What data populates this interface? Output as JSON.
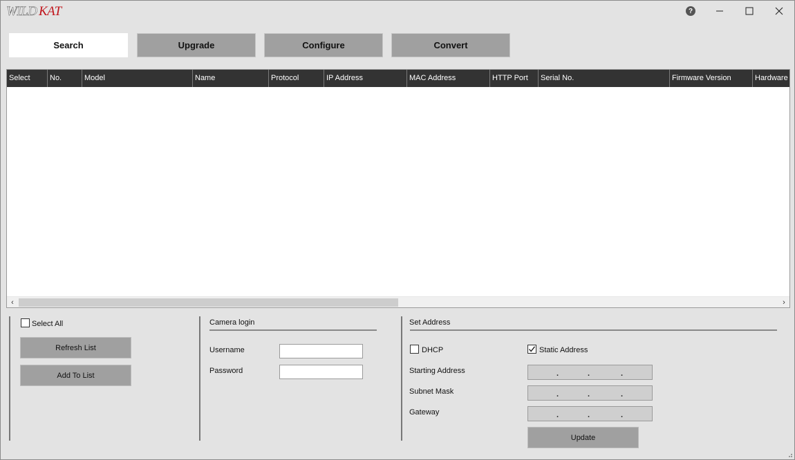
{
  "app": {
    "logo_text": "WildKat"
  },
  "titlebar": {
    "help_glyph": "?",
    "minimize_glyph": "—",
    "maximize_glyph": "☐",
    "close_glyph": "✕"
  },
  "tabs": [
    {
      "label": "Search",
      "active": true
    },
    {
      "label": "Upgrade",
      "active": false
    },
    {
      "label": "Configure",
      "active": false
    },
    {
      "label": "Convert",
      "active": false
    }
  ],
  "grid": {
    "columns": [
      "Select",
      "No.",
      "Model",
      "Name",
      "Protocol",
      "IP Address",
      "MAC Address",
      "HTTP Port",
      "Serial No.",
      "Firmware Version",
      "Hardware"
    ],
    "rows": [],
    "scroll_left_glyph": "‹",
    "scroll_right_glyph": "›"
  },
  "list_panel": {
    "select_all_label": "Select All",
    "select_all_checked": false,
    "refresh_label": "Refresh List",
    "add_label": "Add To List"
  },
  "login_panel": {
    "title": "Camera login",
    "username_label": "Username",
    "username_value": "",
    "password_label": "Password",
    "password_value": ""
  },
  "address_panel": {
    "title": "Set Address",
    "dhcp_label": "DHCP",
    "dhcp_checked": false,
    "static_label": "Static Address",
    "static_checked": true,
    "starting_label": "Starting Address",
    "subnet_label": "Subnet Mask",
    "gateway_label": "Gateway",
    "ip_separator": ".",
    "update_label": "Update"
  },
  "colors": {
    "grid_header": "#333333",
    "tab_inactive": "#a0a0a0",
    "tab_active": "#ffffff",
    "logo_red": "#c0141b",
    "window_bg": "#e3e3e3"
  }
}
